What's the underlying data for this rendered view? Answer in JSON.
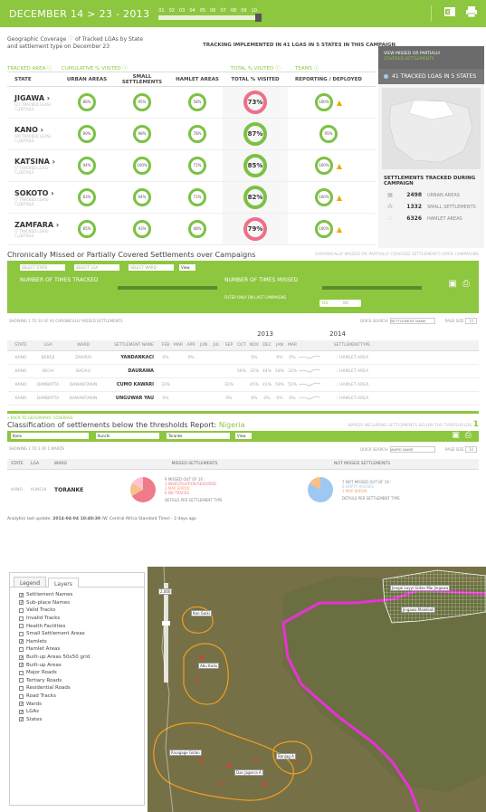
{
  "header": {
    "date_range": "DECEMBER 14 > 23 - 2013",
    "days": [
      "01",
      "02",
      "03",
      "04",
      "05",
      "06",
      "07",
      "08",
      "09",
      "10"
    ],
    "colors": {
      "brand_green": "#8dc63f",
      "alert_pink": "#ef6f8a",
      "warning": "#f7a400"
    }
  },
  "coverage": {
    "title_line1": "Geographic Coverage",
    "title_line1b": "of Tracked LGAs by State",
    "title_line2": "and settlement type on December 23",
    "implemented": "TRACKING IMPLEMENTED IN 41 LGAS IN 5 STATES IN THIS CAMPAIGN",
    "group_tracked_area": "TRACKED AREA",
    "group_cumulative": "CUMULATIVE % VISITED",
    "group_total": "TOTAL % VISITED",
    "group_teams": "TEAMS",
    "columns": [
      "STATE",
      "URBAN AREAS",
      "SMALL SETTLEMENTS",
      "HAMLET AREAS",
      "TOTAL % VISITED",
      "REPORTING / DEPLOYED"
    ],
    "rows": [
      {
        "state": "JIGAWA",
        "sub": "(27 TRACKED LGAS)",
        "details": "DETAILS",
        "urban": "86%",
        "small": "95%",
        "hamlet": "58%",
        "total": "73%",
        "reporting": "100%",
        "total_alert": true,
        "warn": true
      },
      {
        "state": "KANO",
        "sub": "(29 TRACKED LGAS)",
        "details": "DETAILS",
        "urban": "90%",
        "small": "98%",
        "hamlet": "78%",
        "total": "87%",
        "reporting": "95%",
        "total_alert": false,
        "warn": false
      },
      {
        "state": "KATSINA",
        "sub": "(7 TRACKED LGAS)",
        "details": "DETAILS",
        "urban": "94%",
        "small": "100%",
        "hamlet": "71%",
        "total": "85%",
        "reporting": "100%",
        "total_alert": false,
        "warn": true
      },
      {
        "state": "SOKOTO",
        "sub": "(7 TRACKED LGAS)",
        "details": "DETAILS",
        "urban": "83%",
        "small": "94%",
        "hamlet": "71%",
        "total": "82%",
        "reporting": "100%",
        "total_alert": false,
        "warn": true
      },
      {
        "state": "ZAMFARA",
        "sub": "(7 TRACKED LGAS)",
        "details": "DETAILS",
        "urban": "85%",
        "small": "93%",
        "hamlet": "48%",
        "total": "79%",
        "reporting": "100%",
        "total_alert": true,
        "warn": true
      }
    ]
  },
  "sidebar": {
    "view_missed_line1": "VIEW MISSED OR PARTIALLY",
    "view_missed_line2": "COVERED SETTLEMENTS",
    "tracked_count": "41 TRACKED LGAS IN 5 STATES",
    "settlements_title": "SETTLEMENTS TRACKED DURING CAMPAIGN",
    "settlements": [
      {
        "count": "2498",
        "label": "URBAN AREAS",
        "icon": "urban-icon"
      },
      {
        "count": "1332",
        "label": "SMALL SETTLEMENTS",
        "icon": "small-settlement-icon"
      },
      {
        "count": "6326",
        "label": "HAMLET AREAS",
        "icon": "hamlet-icon"
      }
    ]
  },
  "chronic": {
    "title": "Chronically Missed or Partially Covered Settlements over Campaigns",
    "title_right": "CHRONICALLY MISSED OR PARTIALLY COVERED SETTLEMENTS OVER CAMPAIGNS",
    "select_state": "SELECT STATE",
    "select_lga": "SELECT LGA",
    "select_ward": "SELECT WARD",
    "view_button": "View",
    "times_tracked": "NUMBER OF TIMES TRACKED",
    "times_missed": "NUMBER OF TIMES MISSED",
    "filter_last": "FILTER ONLY ON LAST CAMPAIGNS",
    "toggle_yes": "YES",
    "toggle_no": "NO",
    "showing": "SHOWING 1 TO 10 OF 93 CHRONICALLY MISSED SETTLEMENTS",
    "quick_search": "QUICK SEARCH:",
    "search_placeholder": "SETTLEMENT NAME",
    "page_size_label": "PAGE SIZE",
    "page_size": "10",
    "year_2013": "2013",
    "year_2014": "2014",
    "columns": [
      "STATE",
      "LGA",
      "WARD",
      "SETTLEMENT NAME",
      "FEB",
      "MAR",
      "APR",
      "JUN",
      "JUL",
      "SEP",
      "OCT",
      "NOV",
      "DEC",
      "JAN",
      "MAR",
      "",
      "SETTLEMENTTYPE"
    ],
    "rows": [
      {
        "state": "KANO",
        "lga": "BEBEJI",
        "ward": "ZAKIRAI",
        "name": "YANDANKACI",
        "feb": "0%",
        "mar": "",
        "apr": "0%",
        "jun": "",
        "jul": "",
        "sep": "",
        "oct": "",
        "nov": "0%",
        "dec": "",
        "jan": "0%",
        "mar2": "0%",
        "type": "HAMLET AREA"
      },
      {
        "state": "KANO",
        "lga": "BICHI",
        "ward": "BAGAU",
        "name": "DAURAWA",
        "feb": "",
        "mar": "",
        "apr": "",
        "jun": "",
        "jul": "",
        "sep": "",
        "oct": "56%",
        "nov": "32%",
        "dec": "44%",
        "jan": "28%",
        "mar2": "32%",
        "type": "HAMLET AREA"
      },
      {
        "state": "KANO",
        "lga": "DAMBATTA",
        "ward": "DAWANTANIN",
        "name": "CUMO KAWARI",
        "feb": "33%",
        "mar": "",
        "apr": "",
        "jun": "",
        "jul": "",
        "sep": "32%",
        "oct": "",
        "nov": "45%",
        "dec": "41%",
        "jan": "59%",
        "mar2": "51%",
        "type": "HAMLET AREA"
      },
      {
        "state": "KANO",
        "lga": "DAMBATTA",
        "ward": "DAWANTANIN",
        "name": "UNGUWAR YAU",
        "feb": "0%",
        "mar": "",
        "apr": "",
        "jun": "",
        "jul": "",
        "sep": "0%",
        "oct": "",
        "nov": "0%",
        "dec": "0%",
        "jan": "0%",
        "mar2": "0%",
        "type": "HAMLET AREA"
      }
    ]
  },
  "classification": {
    "back_link": "« BACK TO GEOGRAPHIC COVERAGE",
    "title": "Classification of settlements below the thresholds Report:",
    "title_country": "Nigeria",
    "title_right": "WARDS INCLUDING SETTLEMENTS BELOW THE THRESHOLDS",
    "title_count": "1",
    "filter_state": "Kano",
    "filter_lga": "Kunchi",
    "filter_ward": "Toranke",
    "view_button": "View",
    "showing": "SHOWING 1 TO 1 OF 1 WARDS",
    "quick_search": "QUICK SEARCH:",
    "search_placeholder": "WARD NAME",
    "page_size_label": "PAGE SIZE",
    "page_size": "10",
    "columns": [
      "STATE",
      "LGA",
      "WARD",
      "MISSED SETTLEMENTS",
      "NOT MISSED SETTLEMENTS"
    ],
    "row": {
      "state": "KANO",
      "lga": "KUNCHI",
      "ward": "TORANKE",
      "missed_summary": "9 MISSED OUT OF 16 :",
      "missed_items": [
        "1 INVESTIGATION REQUIRED",
        "2 MAP ERROR",
        "6 NO TRACKS"
      ],
      "missed_details": "DETAILS PER SETTLEMENT TYPE",
      "not_missed_summary": "7 NOT MISSED OUT OF 16 :",
      "not_missed_items": [
        "6 EMPTY HOUSES",
        "1 MAP ERROR"
      ],
      "not_missed_details": "DETAILS PER SETTLEMENT TYPE"
    }
  },
  "analytics": {
    "label": "Analytics last update:",
    "timestamp": "2014-04-04 10:40:39",
    "suffix": "(W. Central Africa Standard Time) - 2 days ago"
  },
  "layers": {
    "tabs": [
      "Legend",
      "Layers"
    ],
    "items": [
      {
        "label": "Settlement Names",
        "checked": true
      },
      {
        "label": "Sub-place Names",
        "checked": true
      },
      {
        "label": "Valid Tracks",
        "checked": false
      },
      {
        "label": "Invalid Tracks",
        "checked": false
      },
      {
        "label": "Health Facilities",
        "checked": false
      },
      {
        "label": "Small Settlement Areas",
        "checked": false
      },
      {
        "label": "Hamlets",
        "checked": true
      },
      {
        "label": "Hamlet Areas",
        "checked": false
      },
      {
        "label": "Built-up Areas 50x50 grid",
        "checked": true
      },
      {
        "label": "Built-up Areas",
        "checked": true
      },
      {
        "label": "Major Roads",
        "checked": false
      },
      {
        "label": "Tertiary Roads",
        "checked": false
      },
      {
        "label": "Residential Roads",
        "checked": false
      },
      {
        "label": "Road Tracks",
        "checked": false
      },
      {
        "label": "Wards",
        "checked": true
      },
      {
        "label": "LGAs",
        "checked": true
      },
      {
        "label": "States",
        "checked": true
      }
    ]
  },
  "map": {
    "zoom_label": "2,000",
    "labels": [
      "Kan Gaiki",
      "Jangai Layyi Gidan Mai Jingawa",
      "Jingawa Maleikali",
      "Abu Kadu",
      "Rivagage Gidan",
      "Banjag A",
      "Dan Jagerra A"
    ]
  }
}
